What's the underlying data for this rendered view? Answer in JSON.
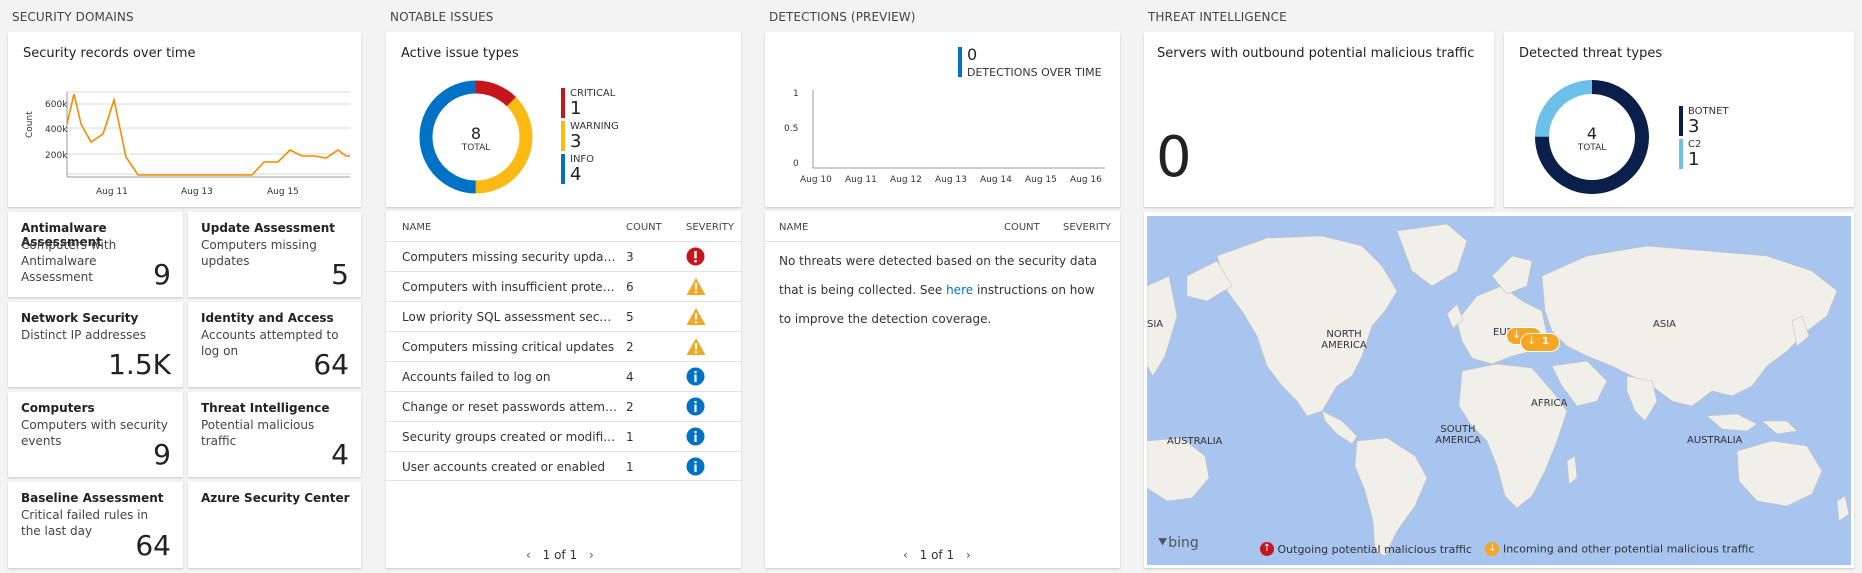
{
  "sections": {
    "security_domains": "SECURITY DOMAINS",
    "notable_issues": "NOTABLE ISSUES",
    "detections": "DETECTIONS (PREVIEW)",
    "threat_intelligence": "THREAT INTELLIGENCE"
  },
  "records_chart": {
    "title": "Security records over time",
    "ylabel": "Count",
    "yticks": [
      "600k",
      "400k",
      "200k"
    ],
    "xticks": [
      "Aug 11",
      "Aug 13",
      "Aug 15"
    ]
  },
  "tiles": [
    {
      "title": "Antimalware Assessment",
      "subtitle": "Computers with Antimalware Assessment",
      "value": "9"
    },
    {
      "title": "Update Assessment",
      "subtitle": "Computers missing updates",
      "value": "5"
    },
    {
      "title": "Network Security",
      "subtitle": "Distinct IP addresses",
      "value": "1.5K"
    },
    {
      "title": "Identity and Access",
      "subtitle": "Accounts attempted to log on",
      "value": "64"
    },
    {
      "title": "Computers",
      "subtitle": "Computers with security events",
      "value": "9"
    },
    {
      "title": "Threat Intelligence",
      "subtitle": "Potential malicious traffic",
      "value": "4"
    },
    {
      "title": "Baseline Assessment",
      "subtitle": "Critical failed rules in the last day",
      "value": "64"
    },
    {
      "title": "Azure Security Center",
      "subtitle": "",
      "value": ""
    }
  ],
  "issues_donut": {
    "title": "Active issue types",
    "total": "8",
    "total_label": "TOTAL",
    "legend": [
      {
        "label": "CRITICAL",
        "value": "1",
        "color": "#c4161c"
      },
      {
        "label": "WARNING",
        "value": "3",
        "color": "#fbb914"
      },
      {
        "label": "INFO",
        "value": "4",
        "color": "#0072c6"
      }
    ]
  },
  "issues_table": {
    "headers": {
      "name": "NAME",
      "count": "COUNT",
      "severity": "SEVERITY"
    },
    "rows": [
      {
        "name": "Computers missing security updates",
        "count": "3",
        "severity": "critical"
      },
      {
        "name": "Computers with insufficient protection",
        "count": "6",
        "severity": "warning"
      },
      {
        "name": "Low priority SQL assessment security r...",
        "count": "5",
        "severity": "warning"
      },
      {
        "name": "Computers missing critical updates",
        "count": "2",
        "severity": "warning"
      },
      {
        "name": "Accounts failed to log on",
        "count": "4",
        "severity": "info"
      },
      {
        "name": "Change or reset passwords attempts",
        "count": "2",
        "severity": "info"
      },
      {
        "name": "Security groups created or modified",
        "count": "1",
        "severity": "info"
      },
      {
        "name": "User accounts created or enabled",
        "count": "1",
        "severity": "info"
      }
    ],
    "pager": "1 of 1"
  },
  "detections_chart": {
    "legend_value": "0",
    "legend_label": "DETECTIONS OVER TIME",
    "yticks": [
      "1",
      "0.5",
      "0"
    ],
    "xticks": [
      "Aug 10",
      "Aug 11",
      "Aug 12",
      "Aug 13",
      "Aug 14",
      "Aug 15",
      "Aug 16"
    ]
  },
  "detections_table": {
    "headers": {
      "name": "NAME",
      "count": "COUNT",
      "severity": "SEVERITY"
    },
    "message_before": "No threats were detected based on the security data that is being collected. See ",
    "link_text": "here",
    "message_after": " instructions on how to improve the detection coverage.",
    "pager": "1 of 1"
  },
  "outbound": {
    "title": "Servers with outbound potential malicious traffic",
    "value": "0"
  },
  "threat_donut": {
    "title": "Detected threat types",
    "total": "4",
    "total_label": "TOTAL",
    "legend": [
      {
        "label": "BOTNET",
        "value": "3",
        "color": "#0b1f4b"
      },
      {
        "label": "C2",
        "value": "1",
        "color": "#6cc0ea"
      }
    ]
  },
  "map": {
    "labels": {
      "north_america": "NORTH AMERICA",
      "south_america": "SOUTH AMERICA",
      "europe": "EUROPE",
      "asia": "ASIA",
      "africa": "AFRICA",
      "australia_left": "AUSTRALIA",
      "australia_right": "AUSTRALIA",
      "asia_left": "SIA"
    },
    "bing": "bing",
    "cluster_count": "1",
    "legend_outgoing": "Outgoing potential malicious traffic",
    "legend_incoming": "Incoming and other potential malicious traffic",
    "colors": {
      "water": "#a7c5ef",
      "land": "#f1efe9",
      "outgoing": "#c4161c",
      "incoming": "#f5a623"
    }
  }
}
